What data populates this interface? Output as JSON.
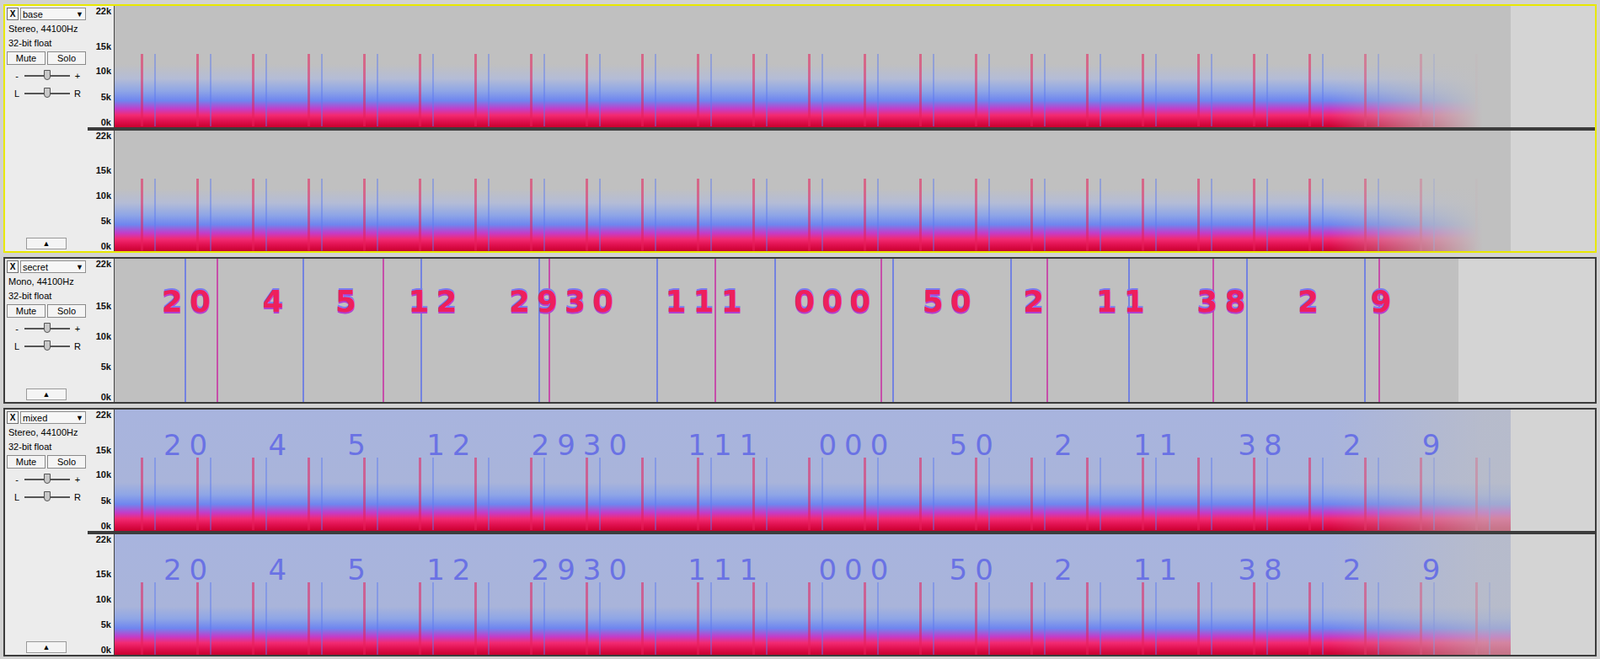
{
  "tracks": [
    {
      "name": "base",
      "kind": "music",
      "selected": true,
      "format": "Stereo, 44100Hz",
      "sample_format": "32-bit float",
      "close": "X",
      "menu": "▼",
      "collapse": "▲",
      "buttons": [
        {
          "label": "Mute",
          "pressed": false
        },
        {
          "label": "Solo",
          "pressed": false
        }
      ],
      "gain": {
        "min_label": "-",
        "max_label": "+",
        "level": 0.5
      },
      "pan": {
        "min_label": "L",
        "max_label": "R",
        "level": 0.5
      },
      "channels": [
        {
          "ticks": [
            {
              "label": "22k",
              "value": 22.05
            },
            {
              "label": "15k",
              "value": 15
            },
            {
              "label": "10k",
              "value": 10
            },
            {
              "label": "5k",
              "value": 5
            },
            {
              "label": "0k",
              "value": 0
            }
          ]
        },
        {
          "ticks": [
            {
              "label": "22k",
              "value": 22.05
            },
            {
              "label": "15k",
              "value": 15
            },
            {
              "label": "10k",
              "value": 10
            },
            {
              "label": "5k",
              "value": 5
            },
            {
              "label": "0k",
              "value": 0
            }
          ]
        }
      ],
      "message": null
    },
    {
      "name": "secret",
      "kind": "secret",
      "selected": false,
      "format": "Mono, 44100Hz",
      "sample_format": "32-bit float",
      "close": "X",
      "menu": "▼",
      "collapse": "▲",
      "buttons": [
        {
          "label": "Mute",
          "pressed": false
        },
        {
          "label": "Solo",
          "pressed": false
        }
      ],
      "gain": {
        "min_label": "-",
        "max_label": "+",
        "level": 0.5
      },
      "pan": {
        "min_label": "L",
        "max_label": "R",
        "level": 0.5
      },
      "channels": [
        {
          "ticks": [
            {
              "label": "22k",
              "value": 22.05
            },
            {
              "label": "15k",
              "value": 15
            },
            {
              "label": "10k",
              "value": 10
            },
            {
              "label": "5k",
              "value": 5
            },
            {
              "label": "0k",
              "value": 0
            }
          ]
        }
      ],
      "message": {
        "kind": "strong",
        "words": [
          "20",
          "4",
          "5",
          "12",
          "2930",
          "111",
          "000",
          "50",
          "2",
          "11",
          "38",
          "2",
          "9"
        ]
      }
    },
    {
      "name": "mixed",
      "kind": "mixed",
      "selected": false,
      "format": "Stereo, 44100Hz",
      "sample_format": "32-bit float",
      "close": "X",
      "menu": "▼",
      "collapse": "▲",
      "buttons": [
        {
          "label": "Mute",
          "pressed": false
        },
        {
          "label": "Solo",
          "pressed": false
        }
      ],
      "gain": {
        "min_label": "-",
        "max_label": "+",
        "level": 0.5
      },
      "pan": {
        "min_label": "L",
        "max_label": "R",
        "level": 0.5
      },
      "channels": [
        {
          "ticks": [
            {
              "label": "22k",
              "value": 22.05
            },
            {
              "label": "15k",
              "value": 15
            },
            {
              "label": "10k",
              "value": 10
            },
            {
              "label": "5k",
              "value": 5
            },
            {
              "label": "0k",
              "value": 0
            }
          ]
        },
        {
          "ticks": [
            {
              "label": "22k",
              "value": 22.05
            },
            {
              "label": "15k",
              "value": 15
            },
            {
              "label": "10k",
              "value": 10
            },
            {
              "label": "5k",
              "value": 5
            },
            {
              "label": "0k",
              "value": 0
            }
          ]
        }
      ],
      "message": {
        "kind": "faint",
        "words": [
          "20",
          "4",
          "5",
          "12",
          "2930",
          "111",
          "000",
          "50",
          "2",
          "11",
          "38",
          "2",
          "9"
        ]
      }
    }
  ]
}
